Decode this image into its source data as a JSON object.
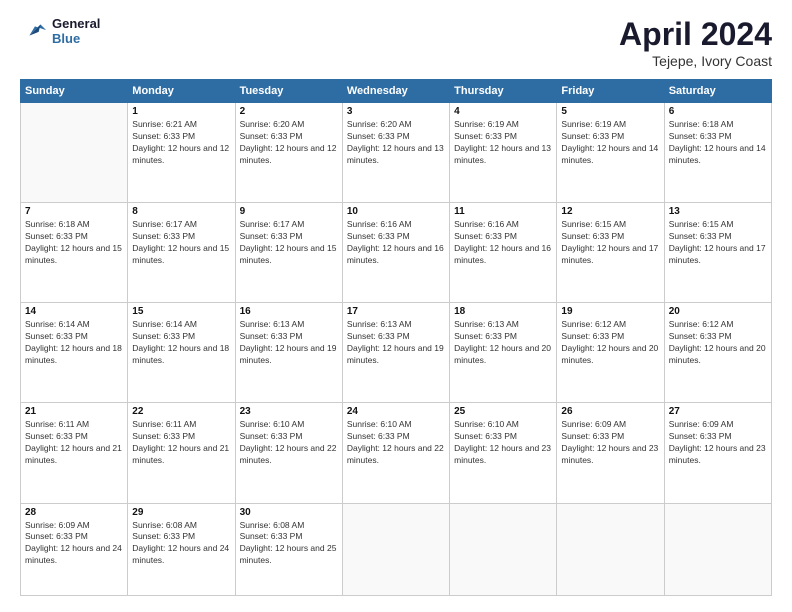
{
  "logo": {
    "line1": "General",
    "line2": "Blue"
  },
  "title": "April 2024",
  "location": "Tejepe, Ivory Coast",
  "days_header": [
    "Sunday",
    "Monday",
    "Tuesday",
    "Wednesday",
    "Thursday",
    "Friday",
    "Saturday"
  ],
  "weeks": [
    [
      {
        "day": "",
        "info": ""
      },
      {
        "day": "1",
        "sunrise": "6:21 AM",
        "sunset": "6:33 PM",
        "daylight": "12 hours and 12 minutes."
      },
      {
        "day": "2",
        "sunrise": "6:20 AM",
        "sunset": "6:33 PM",
        "daylight": "12 hours and 12 minutes."
      },
      {
        "day": "3",
        "sunrise": "6:20 AM",
        "sunset": "6:33 PM",
        "daylight": "12 hours and 13 minutes."
      },
      {
        "day": "4",
        "sunrise": "6:19 AM",
        "sunset": "6:33 PM",
        "daylight": "12 hours and 13 minutes."
      },
      {
        "day": "5",
        "sunrise": "6:19 AM",
        "sunset": "6:33 PM",
        "daylight": "12 hours and 14 minutes."
      },
      {
        "day": "6",
        "sunrise": "6:18 AM",
        "sunset": "6:33 PM",
        "daylight": "12 hours and 14 minutes."
      }
    ],
    [
      {
        "day": "7",
        "sunrise": "6:18 AM",
        "sunset": "6:33 PM",
        "daylight": "12 hours and 15 minutes."
      },
      {
        "day": "8",
        "sunrise": "6:17 AM",
        "sunset": "6:33 PM",
        "daylight": "12 hours and 15 minutes."
      },
      {
        "day": "9",
        "sunrise": "6:17 AM",
        "sunset": "6:33 PM",
        "daylight": "12 hours and 15 minutes."
      },
      {
        "day": "10",
        "sunrise": "6:16 AM",
        "sunset": "6:33 PM",
        "daylight": "12 hours and 16 minutes."
      },
      {
        "day": "11",
        "sunrise": "6:16 AM",
        "sunset": "6:33 PM",
        "daylight": "12 hours and 16 minutes."
      },
      {
        "day": "12",
        "sunrise": "6:15 AM",
        "sunset": "6:33 PM",
        "daylight": "12 hours and 17 minutes."
      },
      {
        "day": "13",
        "sunrise": "6:15 AM",
        "sunset": "6:33 PM",
        "daylight": "12 hours and 17 minutes."
      }
    ],
    [
      {
        "day": "14",
        "sunrise": "6:14 AM",
        "sunset": "6:33 PM",
        "daylight": "12 hours and 18 minutes."
      },
      {
        "day": "15",
        "sunrise": "6:14 AM",
        "sunset": "6:33 PM",
        "daylight": "12 hours and 18 minutes."
      },
      {
        "day": "16",
        "sunrise": "6:13 AM",
        "sunset": "6:33 PM",
        "daylight": "12 hours and 19 minutes."
      },
      {
        "day": "17",
        "sunrise": "6:13 AM",
        "sunset": "6:33 PM",
        "daylight": "12 hours and 19 minutes."
      },
      {
        "day": "18",
        "sunrise": "6:13 AM",
        "sunset": "6:33 PM",
        "daylight": "12 hours and 20 minutes."
      },
      {
        "day": "19",
        "sunrise": "6:12 AM",
        "sunset": "6:33 PM",
        "daylight": "12 hours and 20 minutes."
      },
      {
        "day": "20",
        "sunrise": "6:12 AM",
        "sunset": "6:33 PM",
        "daylight": "12 hours and 20 minutes."
      }
    ],
    [
      {
        "day": "21",
        "sunrise": "6:11 AM",
        "sunset": "6:33 PM",
        "daylight": "12 hours and 21 minutes."
      },
      {
        "day": "22",
        "sunrise": "6:11 AM",
        "sunset": "6:33 PM",
        "daylight": "12 hours and 21 minutes."
      },
      {
        "day": "23",
        "sunrise": "6:10 AM",
        "sunset": "6:33 PM",
        "daylight": "12 hours and 22 minutes."
      },
      {
        "day": "24",
        "sunrise": "6:10 AM",
        "sunset": "6:33 PM",
        "daylight": "12 hours and 22 minutes."
      },
      {
        "day": "25",
        "sunrise": "6:10 AM",
        "sunset": "6:33 PM",
        "daylight": "12 hours and 23 minutes."
      },
      {
        "day": "26",
        "sunrise": "6:09 AM",
        "sunset": "6:33 PM",
        "daylight": "12 hours and 23 minutes."
      },
      {
        "day": "27",
        "sunrise": "6:09 AM",
        "sunset": "6:33 PM",
        "daylight": "12 hours and 23 minutes."
      }
    ],
    [
      {
        "day": "28",
        "sunrise": "6:09 AM",
        "sunset": "6:33 PM",
        "daylight": "12 hours and 24 minutes."
      },
      {
        "day": "29",
        "sunrise": "6:08 AM",
        "sunset": "6:33 PM",
        "daylight": "12 hours and 24 minutes."
      },
      {
        "day": "30",
        "sunrise": "6:08 AM",
        "sunset": "6:33 PM",
        "daylight": "12 hours and 25 minutes."
      },
      {
        "day": "",
        "info": ""
      },
      {
        "day": "",
        "info": ""
      },
      {
        "day": "",
        "info": ""
      },
      {
        "day": "",
        "info": ""
      }
    ]
  ]
}
